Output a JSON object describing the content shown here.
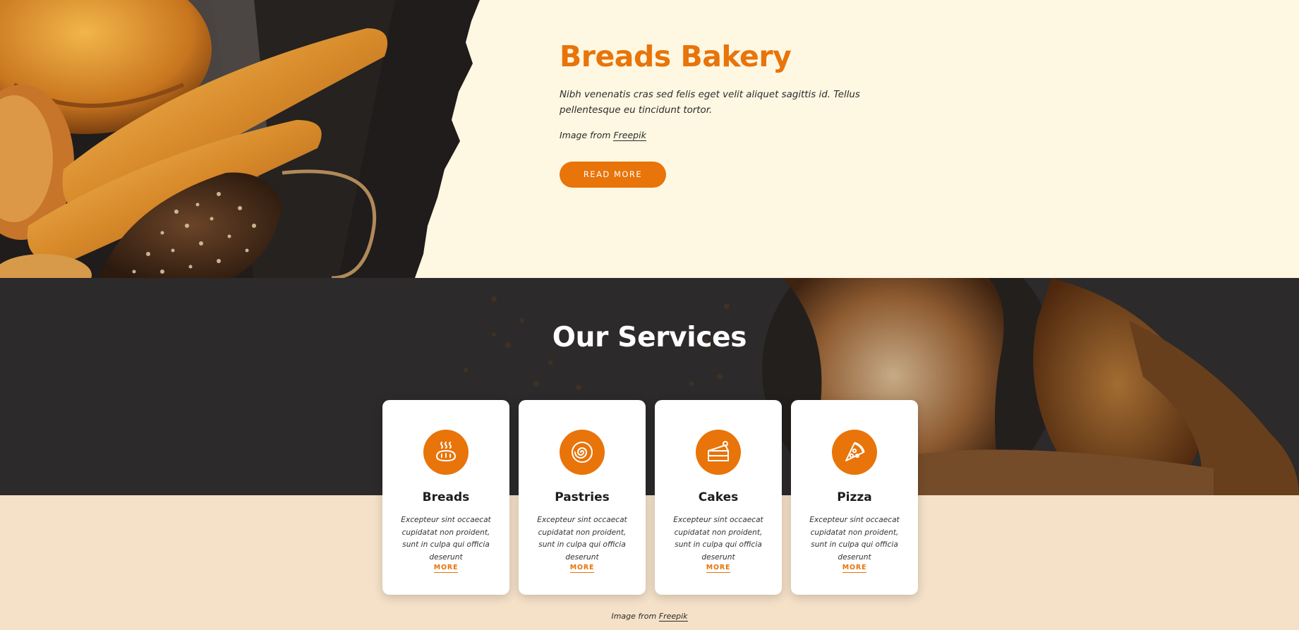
{
  "hero": {
    "title": "Breads Bakery",
    "description": "Nibh venenatis cras sed felis eget velit aliquet sagittis id. Tellus pellentesque eu tincidunt tortor.",
    "credit_prefix": "Image from ",
    "credit_link": "Freepik",
    "button_label": "READ MORE"
  },
  "services": {
    "title": "Our Services",
    "cards": [
      {
        "title": "Breads",
        "icon": "bread-icon",
        "description": "Excepteur sint occaecat cupidatat non proident, sunt in culpa qui officia deserunt",
        "more": "MORE"
      },
      {
        "title": "Pastries",
        "icon": "pastry-icon",
        "description": "Excepteur sint occaecat cupidatat non proident, sunt in culpa qui officia deserunt",
        "more": "MORE"
      },
      {
        "title": "Cakes",
        "icon": "cake-icon",
        "description": "Excepteur sint occaecat cupidatat non proident, sunt in culpa qui officia deserunt",
        "more": "MORE"
      },
      {
        "title": "Pizza",
        "icon": "pizza-icon",
        "description": "Excepteur sint occaecat cupidatat non proident, sunt in culpa qui officia deserunt",
        "more": "MORE"
      }
    ],
    "credit_prefix": "Image from ",
    "credit_link": "Freepik"
  },
  "colors": {
    "accent": "#e8740a",
    "hero_bg": "#fef7e2",
    "lower_bg": "#f5e1c8"
  }
}
